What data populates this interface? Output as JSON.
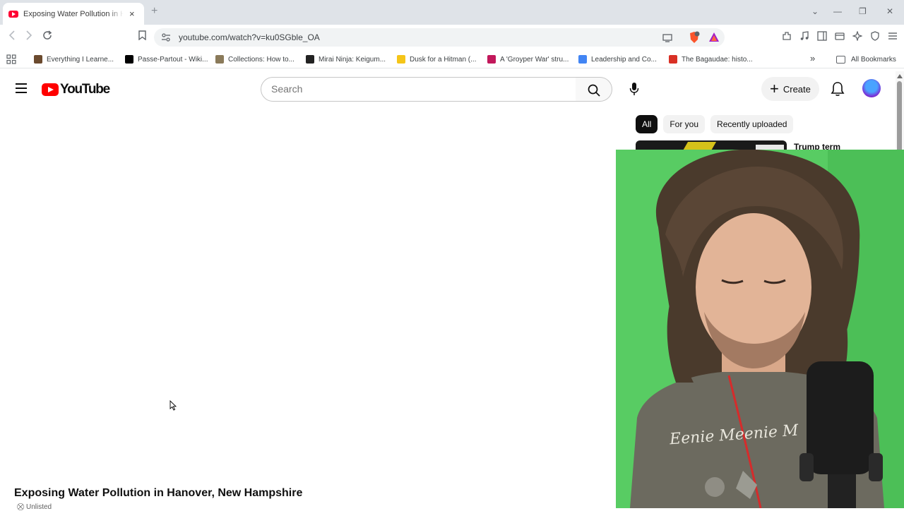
{
  "browser": {
    "tab": {
      "title": "Exposing Water Pollution in Hanover, New Hampshire",
      "close": "×"
    },
    "new_tab": "+",
    "window_controls": {
      "minimize": "—",
      "restore": "❐",
      "close": "✕",
      "tab_search": "⌄"
    },
    "url": "youtube.com/watch?v=ku0SGble_OA",
    "bookmarks": [
      {
        "label": "Everything I Learne...",
        "icon": "image-bookmark-icon",
        "color": "#6b4a2e"
      },
      {
        "label": "Passe-Partout - Wiki...",
        "icon": "wikipedia-icon",
        "color": "#000000"
      },
      {
        "label": "Collections: How to...",
        "icon": "image-bookmark-icon",
        "color": "#8a7a5a"
      },
      {
        "label": "Mirai Ninja: Keigum...",
        "icon": "museum-icon",
        "color": "#222222"
      },
      {
        "label": "Dusk for a Hitman (...",
        "icon": "imdb-icon",
        "color": "#f5c518"
      },
      {
        "label": "A 'Groyper War' stru...",
        "icon": "isd-icon",
        "color": "#c2185b"
      },
      {
        "label": "Leadership and Co...",
        "icon": "google-icon",
        "color": "#4285f4"
      },
      {
        "label": "The Bagaudae: histo...",
        "icon": "flame-icon",
        "color": "#d93025"
      }
    ],
    "more_bookmarks": "»",
    "all_bookmarks": "All Bookmarks"
  },
  "youtube": {
    "logo_text": "YouTube",
    "search_placeholder": "Search",
    "create_label": "Create",
    "chips": [
      "All",
      "For you",
      "Recently uploaded"
    ],
    "recommendation_title": "Trump term",
    "video_title": "Exposing Water Pollution in Hanover, New Hampshire",
    "visibility": "Unlisted"
  },
  "webcam": {
    "shirt_text": "Eenie Meenie M"
  },
  "colors": {
    "youtube_red": "#ff0000",
    "webcam_background": "#52c75e"
  }
}
